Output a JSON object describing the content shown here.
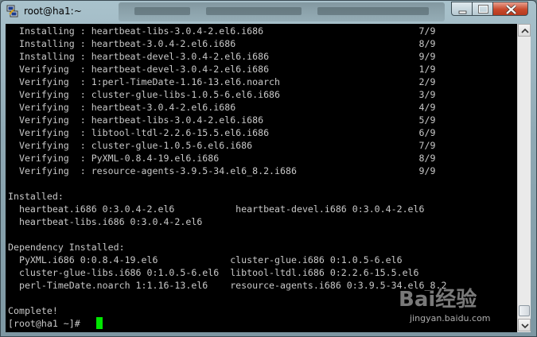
{
  "window": {
    "title": "root@ha1:~"
  },
  "terminal": {
    "lines": [
      "  Installing : heartbeat-libs-3.0.4-2.el6.i686                            7/9",
      "  Installing : heartbeat-3.0.4-2.el6.i686                                 8/9",
      "  Installing : heartbeat-devel-3.0.4-2.el6.i686                           9/9",
      "  Verifying  : heartbeat-devel-3.0.4-2.el6.i686                           1/9",
      "  Verifying  : 1:perl-TimeDate-1.16-13.el6.noarch                         2/9",
      "  Verifying  : cluster-glue-libs-1.0.5-6.el6.i686                         3/9",
      "  Verifying  : heartbeat-3.0.4-2.el6.i686                                 4/9",
      "  Verifying  : heartbeat-libs-3.0.4-2.el6.i686                            5/9",
      "  Verifying  : libtool-ltdl-2.2.6-15.5.el6.i686                           6/9",
      "  Verifying  : cluster-glue-1.0.5-6.el6.i686                              7/9",
      "  Verifying  : PyXML-0.8.4-19.el6.i686                                    8/9",
      "  Verifying  : resource-agents-3.9.5-34.el6_8.2.i686                      9/9",
      "",
      "Installed:",
      "  heartbeat.i686 0:3.0.4-2.el6           heartbeat-devel.i686 0:3.0.4-2.el6",
      "  heartbeat-libs.i686 0:3.0.4-2.el6",
      "",
      "Dependency Installed:",
      "  PyXML.i686 0:0.8.4-19.el6             cluster-glue.i686 0:1.0.5-6.el6",
      "  cluster-glue-libs.i686 0:1.0.5-6.el6  libtool-ltdl.i686 0:2.2.6-15.5.el6",
      "  perl-TimeDate.noarch 1:1.16-13.el6    resource-agents.i686 0:3.9.5-34.el6_8.2",
      "",
      "Complete!",
      "[root@ha1 ~]# "
    ]
  },
  "watermark": {
    "logo": "Bai经验",
    "url": "jingyan.baidu.com"
  },
  "colors": {
    "terminal_bg": "#000000",
    "terminal_fg": "#c8c8c8",
    "cursor": "#00e600"
  }
}
